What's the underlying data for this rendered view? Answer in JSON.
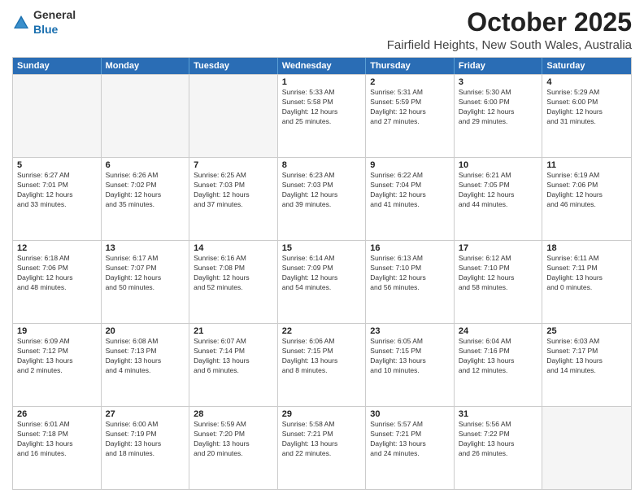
{
  "header": {
    "logo_general": "General",
    "logo_blue": "Blue",
    "month": "October 2025",
    "location": "Fairfield Heights, New South Wales, Australia"
  },
  "days_of_week": [
    "Sunday",
    "Monday",
    "Tuesday",
    "Wednesday",
    "Thursday",
    "Friday",
    "Saturday"
  ],
  "weeks": [
    [
      {
        "day": "",
        "lines": []
      },
      {
        "day": "",
        "lines": []
      },
      {
        "day": "",
        "lines": []
      },
      {
        "day": "1",
        "lines": [
          "Sunrise: 5:33 AM",
          "Sunset: 5:58 PM",
          "Daylight: 12 hours",
          "and 25 minutes."
        ]
      },
      {
        "day": "2",
        "lines": [
          "Sunrise: 5:31 AM",
          "Sunset: 5:59 PM",
          "Daylight: 12 hours",
          "and 27 minutes."
        ]
      },
      {
        "day": "3",
        "lines": [
          "Sunrise: 5:30 AM",
          "Sunset: 6:00 PM",
          "Daylight: 12 hours",
          "and 29 minutes."
        ]
      },
      {
        "day": "4",
        "lines": [
          "Sunrise: 5:29 AM",
          "Sunset: 6:00 PM",
          "Daylight: 12 hours",
          "and 31 minutes."
        ]
      }
    ],
    [
      {
        "day": "5",
        "lines": [
          "Sunrise: 6:27 AM",
          "Sunset: 7:01 PM",
          "Daylight: 12 hours",
          "and 33 minutes."
        ]
      },
      {
        "day": "6",
        "lines": [
          "Sunrise: 6:26 AM",
          "Sunset: 7:02 PM",
          "Daylight: 12 hours",
          "and 35 minutes."
        ]
      },
      {
        "day": "7",
        "lines": [
          "Sunrise: 6:25 AM",
          "Sunset: 7:03 PM",
          "Daylight: 12 hours",
          "and 37 minutes."
        ]
      },
      {
        "day": "8",
        "lines": [
          "Sunrise: 6:23 AM",
          "Sunset: 7:03 PM",
          "Daylight: 12 hours",
          "and 39 minutes."
        ]
      },
      {
        "day": "9",
        "lines": [
          "Sunrise: 6:22 AM",
          "Sunset: 7:04 PM",
          "Daylight: 12 hours",
          "and 41 minutes."
        ]
      },
      {
        "day": "10",
        "lines": [
          "Sunrise: 6:21 AM",
          "Sunset: 7:05 PM",
          "Daylight: 12 hours",
          "and 44 minutes."
        ]
      },
      {
        "day": "11",
        "lines": [
          "Sunrise: 6:19 AM",
          "Sunset: 7:06 PM",
          "Daylight: 12 hours",
          "and 46 minutes."
        ]
      }
    ],
    [
      {
        "day": "12",
        "lines": [
          "Sunrise: 6:18 AM",
          "Sunset: 7:06 PM",
          "Daylight: 12 hours",
          "and 48 minutes."
        ]
      },
      {
        "day": "13",
        "lines": [
          "Sunrise: 6:17 AM",
          "Sunset: 7:07 PM",
          "Daylight: 12 hours",
          "and 50 minutes."
        ]
      },
      {
        "day": "14",
        "lines": [
          "Sunrise: 6:16 AM",
          "Sunset: 7:08 PM",
          "Daylight: 12 hours",
          "and 52 minutes."
        ]
      },
      {
        "day": "15",
        "lines": [
          "Sunrise: 6:14 AM",
          "Sunset: 7:09 PM",
          "Daylight: 12 hours",
          "and 54 minutes."
        ]
      },
      {
        "day": "16",
        "lines": [
          "Sunrise: 6:13 AM",
          "Sunset: 7:10 PM",
          "Daylight: 12 hours",
          "and 56 minutes."
        ]
      },
      {
        "day": "17",
        "lines": [
          "Sunrise: 6:12 AM",
          "Sunset: 7:10 PM",
          "Daylight: 12 hours",
          "and 58 minutes."
        ]
      },
      {
        "day": "18",
        "lines": [
          "Sunrise: 6:11 AM",
          "Sunset: 7:11 PM",
          "Daylight: 13 hours",
          "and 0 minutes."
        ]
      }
    ],
    [
      {
        "day": "19",
        "lines": [
          "Sunrise: 6:09 AM",
          "Sunset: 7:12 PM",
          "Daylight: 13 hours",
          "and 2 minutes."
        ]
      },
      {
        "day": "20",
        "lines": [
          "Sunrise: 6:08 AM",
          "Sunset: 7:13 PM",
          "Daylight: 13 hours",
          "and 4 minutes."
        ]
      },
      {
        "day": "21",
        "lines": [
          "Sunrise: 6:07 AM",
          "Sunset: 7:14 PM",
          "Daylight: 13 hours",
          "and 6 minutes."
        ]
      },
      {
        "day": "22",
        "lines": [
          "Sunrise: 6:06 AM",
          "Sunset: 7:15 PM",
          "Daylight: 13 hours",
          "and 8 minutes."
        ]
      },
      {
        "day": "23",
        "lines": [
          "Sunrise: 6:05 AM",
          "Sunset: 7:15 PM",
          "Daylight: 13 hours",
          "and 10 minutes."
        ]
      },
      {
        "day": "24",
        "lines": [
          "Sunrise: 6:04 AM",
          "Sunset: 7:16 PM",
          "Daylight: 13 hours",
          "and 12 minutes."
        ]
      },
      {
        "day": "25",
        "lines": [
          "Sunrise: 6:03 AM",
          "Sunset: 7:17 PM",
          "Daylight: 13 hours",
          "and 14 minutes."
        ]
      }
    ],
    [
      {
        "day": "26",
        "lines": [
          "Sunrise: 6:01 AM",
          "Sunset: 7:18 PM",
          "Daylight: 13 hours",
          "and 16 minutes."
        ]
      },
      {
        "day": "27",
        "lines": [
          "Sunrise: 6:00 AM",
          "Sunset: 7:19 PM",
          "Daylight: 13 hours",
          "and 18 minutes."
        ]
      },
      {
        "day": "28",
        "lines": [
          "Sunrise: 5:59 AM",
          "Sunset: 7:20 PM",
          "Daylight: 13 hours",
          "and 20 minutes."
        ]
      },
      {
        "day": "29",
        "lines": [
          "Sunrise: 5:58 AM",
          "Sunset: 7:21 PM",
          "Daylight: 13 hours",
          "and 22 minutes."
        ]
      },
      {
        "day": "30",
        "lines": [
          "Sunrise: 5:57 AM",
          "Sunset: 7:21 PM",
          "Daylight: 13 hours",
          "and 24 minutes."
        ]
      },
      {
        "day": "31",
        "lines": [
          "Sunrise: 5:56 AM",
          "Sunset: 7:22 PM",
          "Daylight: 13 hours",
          "and 26 minutes."
        ]
      },
      {
        "day": "",
        "lines": []
      }
    ]
  ]
}
